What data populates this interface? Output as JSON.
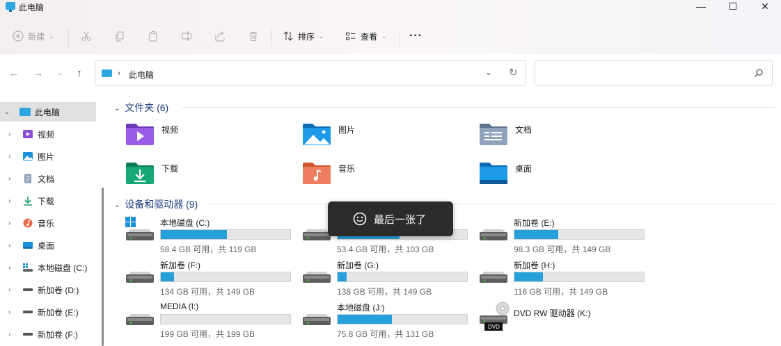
{
  "window": {
    "title": "此电脑",
    "controls": [
      "—",
      "☐",
      "✕"
    ]
  },
  "toolbar": {
    "new_label": "新建",
    "sort_label": "排序",
    "view_label": "查看",
    "more": "···"
  },
  "address": {
    "separator": "›",
    "crumb": "此电脑"
  },
  "search": {
    "placeholder": ""
  },
  "sidebar": {
    "items": [
      {
        "label": "此电脑",
        "icon": "pc-icon"
      },
      {
        "label": "视频",
        "icon": "video-icon"
      },
      {
        "label": "图片",
        "icon": "pictures-icon"
      },
      {
        "label": "文档",
        "icon": "documents-icon"
      },
      {
        "label": "下载",
        "icon": "download-icon"
      },
      {
        "label": "音乐",
        "icon": "music-icon"
      },
      {
        "label": "桌面",
        "icon": "desktop-icon"
      },
      {
        "label": "本地磁盘 (C:)",
        "icon": "windows-drive-icon"
      },
      {
        "label": "新加卷 (D:)",
        "icon": "drive-icon"
      },
      {
        "label": "新加卷 (E:)",
        "icon": "drive-icon"
      },
      {
        "label": "新加卷 (F:)",
        "icon": "drive-icon"
      }
    ]
  },
  "folders_section": {
    "title": "文件夹 (6)"
  },
  "folders": [
    {
      "name": "视频",
      "icon": "video-folder-icon"
    },
    {
      "name": "图片",
      "icon": "pictures-folder-icon"
    },
    {
      "name": "文档",
      "icon": "documents-folder-icon"
    },
    {
      "name": "下载",
      "icon": "download-folder-icon"
    },
    {
      "name": "音乐",
      "icon": "music-folder-icon"
    },
    {
      "name": "桌面",
      "icon": "desktop-folder-icon"
    }
  ],
  "drives_section": {
    "title": "设备和驱动器 (9)"
  },
  "drives": [
    {
      "name": "本地磁盘 (C:)",
      "free": "58.4 GB 可用，共 119 GB",
      "used_fraction": 0.51
    },
    {
      "name": "新加",
      "free": "53.4 GB 可用，共 103 GB",
      "used_fraction": 0.48
    },
    {
      "name": "新加卷 (E:)",
      "free": "98.3 GB 可用，共 149 GB",
      "used_fraction": 0.34
    },
    {
      "name": "新加卷 (F:)",
      "free": "134 GB 可用，共 149 GB",
      "used_fraction": 0.1
    },
    {
      "name": "新加卷 (G:)",
      "free": "138 GB 可用，共 149 GB",
      "used_fraction": 0.07
    },
    {
      "name": "新加卷 (H:)",
      "free": "116 GB 可用，共 149 GB",
      "used_fraction": 0.22
    },
    {
      "name": "MEDIA (I:)",
      "free": "199 GB 可用，共 199 GB",
      "used_fraction": 0.0
    },
    {
      "name": "本地磁盘 (J:)",
      "free": "75.8 GB 可用，共 131 GB",
      "used_fraction": 0.42
    }
  ],
  "dvd": {
    "name": "DVD RW 驱动器 (K:)",
    "badge": "DVD"
  },
  "toast": {
    "text": "最后一张了"
  },
  "colors": {
    "accent": "#26a0da",
    "section_title": "#1e3b7c",
    "selected_bg": "#e0e0e0"
  }
}
